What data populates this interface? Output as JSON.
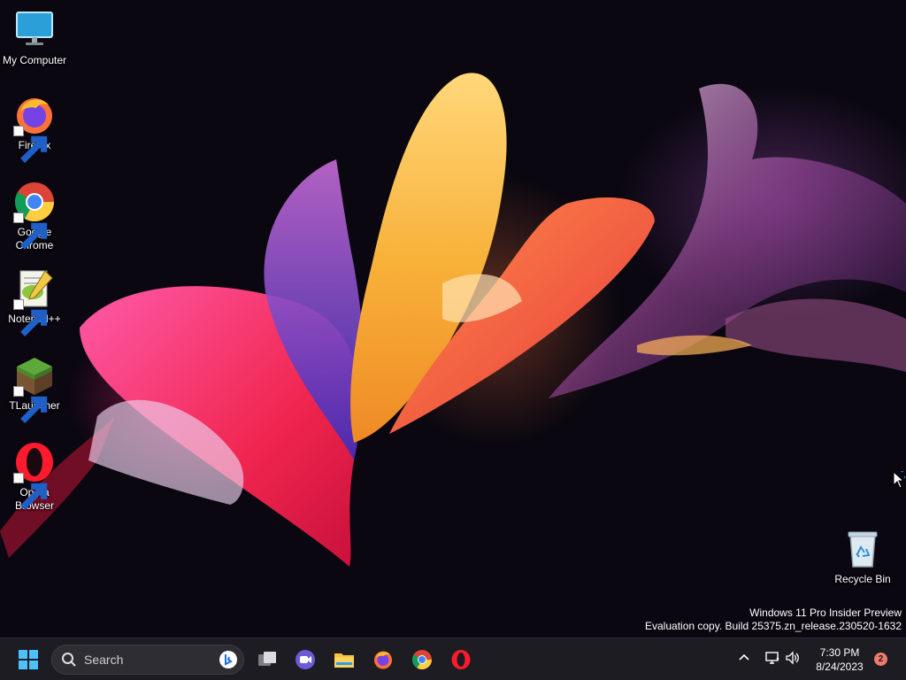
{
  "desktop": {
    "icons": [
      {
        "label": "My Computer",
        "icon": "monitor-icon",
        "shortcut": false
      },
      {
        "label": "Firefox",
        "icon": "firefox-icon",
        "shortcut": true
      },
      {
        "label": "Google Chrome",
        "icon": "chrome-icon",
        "shortcut": true
      },
      {
        "label": "Notepad++",
        "icon": "notepadpp-icon",
        "shortcut": true
      },
      {
        "label": "TLauncher",
        "icon": "grass-block-icon",
        "shortcut": true
      },
      {
        "label": "Opera Browser",
        "icon": "opera-icon",
        "shortcut": true
      },
      {
        "label": "Recycle Bin",
        "icon": "recycle-bin-icon",
        "shortcut": false
      }
    ],
    "watermark": {
      "line1": "Windows 11 Pro Insider Preview",
      "line2": "Evaluation copy. Build 25375.zn_release.230520-1632"
    }
  },
  "taskbar": {
    "search_placeholder": "Search",
    "pinned": [
      "start-icon",
      "task-view-icon",
      "meet-icon",
      "file-explorer-icon",
      "firefox-icon",
      "chrome-icon",
      "opera-icon"
    ],
    "tray": {
      "time": "7:30 PM",
      "date": "8/24/2023",
      "notifications": "2"
    }
  },
  "colors": {
    "taskbar": "#1c1c22",
    "search_box": "#2d2d33",
    "badge": "#f07a6b"
  }
}
